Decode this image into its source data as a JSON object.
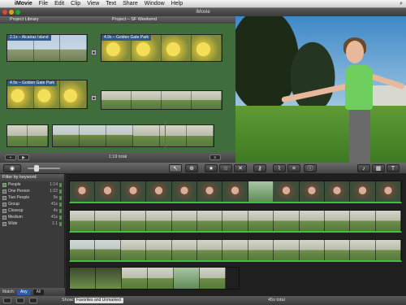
{
  "menubar": {
    "apple": "",
    "app": "iMovie",
    "items": [
      "File",
      "Edit",
      "Clip",
      "View",
      "Text",
      "Share",
      "Window",
      "Help"
    ]
  },
  "window": {
    "title": "iMovie"
  },
  "library": {
    "label": "Project Library",
    "project_title": "Project – SF Weekend"
  },
  "project_clips": [
    {
      "label": "2.1s – Alcatraz Island"
    },
    {
      "label": "4.9s – Golden Gate Park"
    },
    {
      "label": "4.9s – Golden Gate Park"
    }
  ],
  "project_footer": {
    "total": "1:19 total"
  },
  "filter": {
    "title": "Filter by keyword",
    "keywords": [
      {
        "name": "People",
        "time": "1:14",
        "checked": true
      },
      {
        "name": "One Person",
        "time": "1:22",
        "checked": false
      },
      {
        "name": "Two People",
        "time": "9s",
        "checked": false
      },
      {
        "name": "Group",
        "time": "41s",
        "checked": false
      },
      {
        "name": "Closeup",
        "time": "4s",
        "checked": false
      },
      {
        "name": "Medium",
        "time": "41s",
        "checked": false
      },
      {
        "name": "Wide",
        "time": "1:1",
        "checked": false
      }
    ],
    "match_label": "Match:",
    "match_any": "Any",
    "match_all": "All"
  },
  "statusbar": {
    "show_label": "Show:",
    "show_value": "Favorites and Unmarked",
    "total": "45s total"
  },
  "colors": {
    "project_bg": "#3f6e3c",
    "clip_label": "#2f5a8a",
    "favorite": "#3fbf3f",
    "match_any": "#2a5aa8"
  },
  "toolbar_icons": [
    "pointer-icon",
    "add-to-project-icon",
    "favorite-icon",
    "unmark-icon",
    "reject-icon",
    "keyword-icon",
    "eyedropper-icon",
    "crop-icon",
    "info-icon"
  ]
}
